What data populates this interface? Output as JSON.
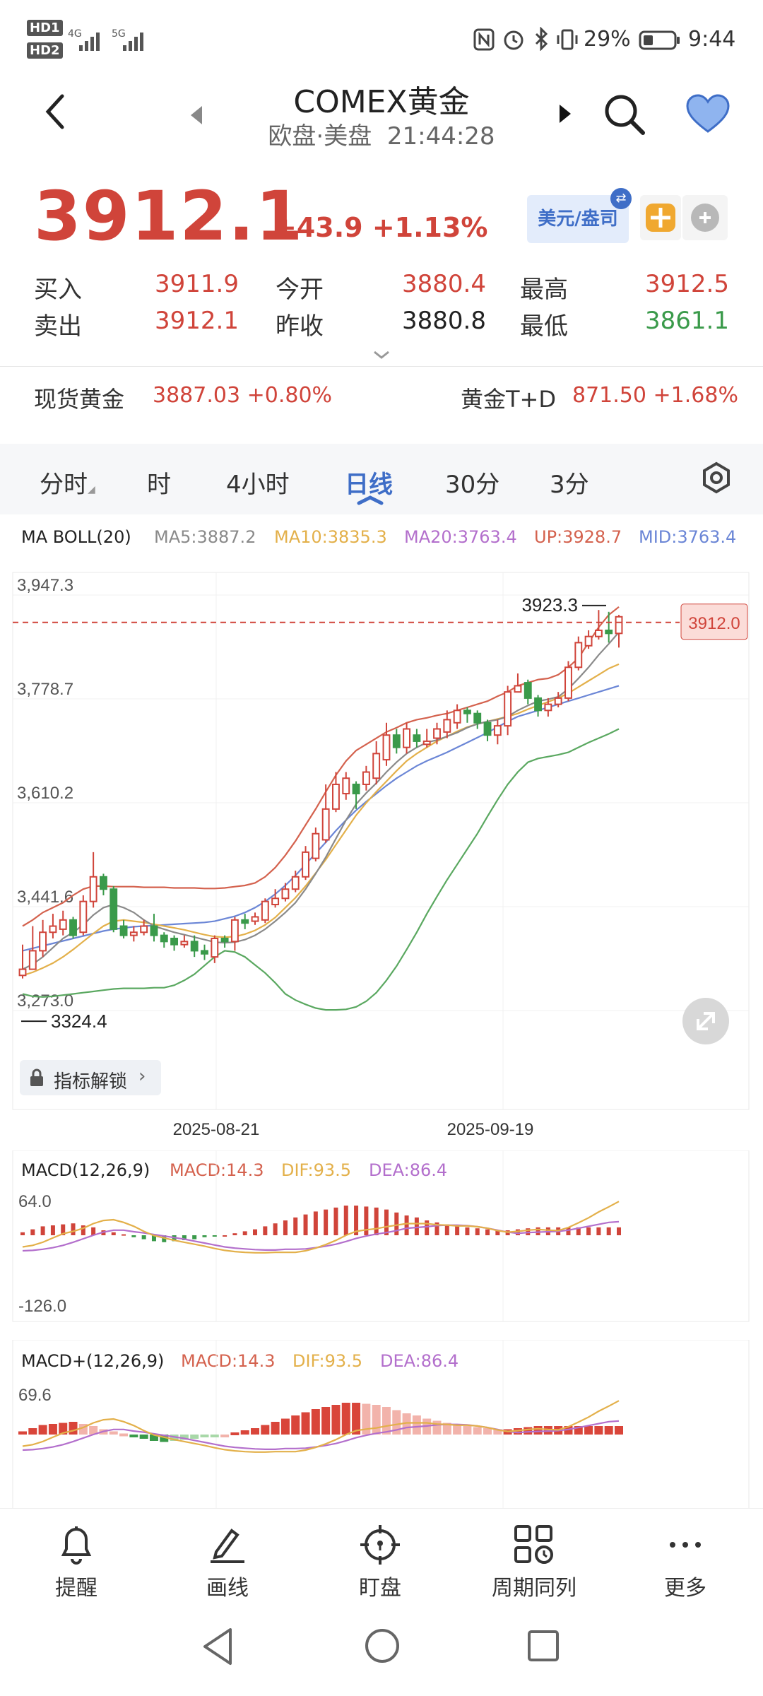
{
  "status_bar": {
    "hd1": "HD1",
    "hd2": "HD2",
    "net1": "4G",
    "net2": "5G",
    "battery": "29%",
    "time": "9:44"
  },
  "header": {
    "title": "COMEX黄金",
    "session": "欧盘·美盘",
    "clock": "21:44:28"
  },
  "quote": {
    "price": "3912.1",
    "change": "+43.9 +1.13%",
    "currency_badge": "美元/盎司",
    "rows": [
      {
        "l1": "买入",
        "v1": "3911.9",
        "l2": "今开",
        "v2": "3880.4",
        "l3": "最高",
        "v3": "3912.5"
      },
      {
        "l1": "卖出",
        "v1": "3912.1",
        "l2": "昨收",
        "v2": "3880.8",
        "l3": "最低",
        "v3": "3861.1"
      }
    ]
  },
  "related": {
    "left_label": "现货黄金",
    "left_value": "3887.03 +0.80%",
    "right_label": "黄金T+D",
    "right_value": "871.50 +1.68%"
  },
  "tabs": [
    "分时",
    "时",
    "4小时",
    "日线",
    "30分",
    "3分"
  ],
  "indicator_bar": {
    "name": "MA BOLL(20)",
    "ma5": "MA5:3887.2",
    "ma10": "MA10:3835.3",
    "ma20": "MA20:3763.4",
    "up": "UP:3928.7",
    "mid": "MID:3763.4"
  },
  "chart_data": {
    "type": "candlestick",
    "y_ticks": [
      "3,947.3",
      "3,778.7",
      "3,610.2",
      "3,441.6",
      "3,273.0"
    ],
    "ylim": [
      3273.0,
      3947.3
    ],
    "x_ticks": [
      "2025-08-21",
      "2025-09-19"
    ],
    "max_label": "3923.3",
    "min_label": "3324.4",
    "current_label": "3912.0",
    "candles": [
      [
        3340,
        3330,
        3380,
        3325
      ],
      [
        3370,
        3340,
        3410,
        3340
      ],
      [
        3400,
        3370,
        3420,
        3360
      ],
      [
        3410,
        3400,
        3430,
        3390
      ],
      [
        3420,
        3405,
        3435,
        3395
      ],
      [
        3395,
        3420,
        3425,
        3390
      ],
      [
        3450,
        3400,
        3460,
        3395
      ],
      [
        3490,
        3450,
        3530,
        3440
      ],
      [
        3470,
        3490,
        3495,
        3460
      ],
      [
        3405,
        3470,
        3475,
        3400
      ],
      [
        3395,
        3410,
        3420,
        3390
      ],
      [
        3400,
        3395,
        3410,
        3385
      ],
      [
        3410,
        3400,
        3420,
        3395
      ],
      [
        3395,
        3410,
        3430,
        3385
      ],
      [
        3385,
        3395,
        3400,
        3375
      ],
      [
        3380,
        3390,
        3395,
        3370
      ],
      [
        3385,
        3380,
        3395,
        3375
      ],
      [
        3370,
        3385,
        3395,
        3360
      ],
      [
        3365,
        3370,
        3380,
        3355
      ],
      [
        3390,
        3360,
        3395,
        3350
      ],
      [
        3385,
        3390,
        3395,
        3375
      ],
      [
        3420,
        3385,
        3425,
        3370
      ],
      [
        3415,
        3420,
        3430,
        3405
      ],
      [
        3425,
        3418,
        3432,
        3412
      ],
      [
        3450,
        3420,
        3455,
        3415
      ],
      [
        3455,
        3445,
        3470,
        3440
      ],
      [
        3470,
        3455,
        3480,
        3450
      ],
      [
        3490,
        3470,
        3500,
        3465
      ],
      [
        3530,
        3490,
        3540,
        3485
      ],
      [
        3560,
        3520,
        3570,
        3515
      ],
      [
        3600,
        3550,
        3640,
        3545
      ],
      [
        3640,
        3600,
        3660,
        3595
      ],
      [
        3650,
        3625,
        3660,
        3615
      ],
      [
        3625,
        3640,
        3645,
        3600
      ],
      [
        3660,
        3640,
        3670,
        3630
      ],
      [
        3690,
        3650,
        3710,
        3640
      ],
      [
        3720,
        3680,
        3740,
        3670
      ],
      [
        3700,
        3720,
        3730,
        3690
      ],
      [
        3730,
        3700,
        3740,
        3690
      ],
      [
        3710,
        3720,
        3730,
        3700
      ],
      [
        3710,
        3705,
        3730,
        3700
      ],
      [
        3730,
        3715,
        3740,
        3705
      ],
      [
        3745,
        3725,
        3760,
        3715
      ],
      [
        3760,
        3740,
        3770,
        3730
      ],
      [
        3755,
        3760,
        3765,
        3740
      ],
      [
        3740,
        3755,
        3760,
        3730
      ],
      [
        3720,
        3740,
        3745,
        3710
      ],
      [
        3735,
        3720,
        3745,
        3705
      ],
      [
        3790,
        3735,
        3800,
        3720
      ],
      [
        3800,
        3790,
        3820,
        3790
      ],
      [
        3780,
        3805,
        3810,
        3770
      ],
      [
        3760,
        3780,
        3785,
        3750
      ],
      [
        3770,
        3760,
        3780,
        3750
      ],
      [
        3780,
        3770,
        3790,
        3765
      ],
      [
        3830,
        3780,
        3840,
        3775
      ],
      [
        3870,
        3830,
        3880,
        3825
      ],
      [
        3880,
        3865,
        3890,
        3860
      ],
      [
        3890,
        3880,
        3923,
        3875
      ],
      [
        3885,
        3890,
        3920,
        3870
      ],
      [
        3912,
        3885,
        3915,
        3862
      ]
    ],
    "lines": {
      "boll_up": [
        3410,
        3420,
        3432,
        3440,
        3448,
        3460,
        3470,
        3475,
        3475,
        3474,
        3474,
        3474,
        3473,
        3473,
        3473,
        3472,
        3472,
        3472,
        3471,
        3471,
        3472,
        3474,
        3476,
        3480,
        3490,
        3505,
        3525,
        3548,
        3574,
        3600,
        3628,
        3655,
        3678,
        3695,
        3705,
        3715,
        3725,
        3732,
        3740,
        3745,
        3748,
        3752,
        3755,
        3760,
        3765,
        3770,
        3775,
        3783,
        3790,
        3800,
        3805,
        3810,
        3812,
        3818,
        3830,
        3845,
        3870,
        3895,
        3915,
        3928
      ],
      "mid": [
        3370,
        3374,
        3378,
        3382,
        3386,
        3390,
        3394,
        3398,
        3402,
        3405,
        3407,
        3409,
        3410,
        3411,
        3412,
        3413,
        3414,
        3415,
        3416,
        3418,
        3422,
        3426,
        3432,
        3440,
        3450,
        3462,
        3476,
        3492,
        3510,
        3528,
        3546,
        3565,
        3582,
        3598,
        3612,
        3625,
        3638,
        3650,
        3660,
        3670,
        3678,
        3685,
        3692,
        3700,
        3708,
        3716,
        3724,
        3733,
        3742,
        3750,
        3755,
        3760,
        3765,
        3770,
        3775,
        3780,
        3785,
        3790,
        3795,
        3800
      ],
      "boll_low": [
        3300,
        3296,
        3295,
        3296,
        3298,
        3300,
        3302,
        3304,
        3306,
        3308,
        3309,
        3309,
        3309,
        3310,
        3310,
        3314,
        3322,
        3332,
        3346,
        3360,
        3370,
        3368,
        3360,
        3347,
        3334,
        3318,
        3300,
        3290,
        3283,
        3277,
        3274,
        3274,
        3275,
        3279,
        3288,
        3302,
        3322,
        3345,
        3372,
        3400,
        3430,
        3458,
        3485,
        3510,
        3535,
        3560,
        3588,
        3615,
        3640,
        3660,
        3676,
        3682,
        3685,
        3688,
        3692,
        3700,
        3708,
        3715,
        3722,
        3730
      ],
      "ma5": [
        3340,
        3348,
        3360,
        3375,
        3390,
        3400,
        3412,
        3428,
        3440,
        3445,
        3440,
        3432,
        3420,
        3410,
        3405,
        3400,
        3396,
        3392,
        3388,
        3384,
        3383,
        3384,
        3388,
        3395,
        3405,
        3418,
        3432,
        3448,
        3470,
        3495,
        3522,
        3552,
        3582,
        3608,
        3626,
        3642,
        3660,
        3676,
        3690,
        3700,
        3708,
        3712,
        3718,
        3724,
        3732,
        3738,
        3742,
        3745,
        3750,
        3760,
        3768,
        3775,
        3778,
        3782,
        3795,
        3812,
        3830,
        3850,
        3868,
        3887
      ],
      "ma10": [
        3330,
        3335,
        3342,
        3350,
        3360,
        3372,
        3385,
        3398,
        3410,
        3418,
        3420,
        3418,
        3416,
        3413,
        3410,
        3407,
        3404,
        3400,
        3396,
        3393,
        3392,
        3393,
        3397,
        3403,
        3412,
        3424,
        3440,
        3456,
        3475,
        3496,
        3518,
        3542,
        3566,
        3590,
        3610,
        3628,
        3645,
        3662,
        3678,
        3690,
        3700,
        3710,
        3718,
        3726,
        3733,
        3738,
        3742,
        3746,
        3750,
        3755,
        3762,
        3768,
        3774,
        3780,
        3788,
        3798,
        3808,
        3818,
        3828,
        3835
      ]
    }
  },
  "chart_misc": {
    "unlock_label": "指标解锁"
  },
  "macd1": {
    "name": "MACD(12,26,9)",
    "macd": "MACD:14.3",
    "dif": "DIF:93.5",
    "dea": "DEA:86.4",
    "ticks": [
      "64.0",
      "-126.0"
    ],
    "hist": [
      3,
      6,
      9,
      10,
      11,
      12,
      10,
      8,
      5,
      3,
      1,
      -2,
      -4,
      -6,
      -7,
      -6,
      -5,
      -4,
      -2,
      -1,
      0,
      2,
      4,
      6,
      9,
      12,
      15,
      18,
      21,
      24,
      26,
      28,
      30,
      30,
      29,
      28,
      26,
      23,
      20,
      18,
      15,
      13,
      11,
      9,
      8,
      7,
      6,
      5,
      5,
      6,
      7,
      8,
      8,
      8,
      8,
      8,
      8,
      8,
      8,
      8
    ]
  },
  "macd2": {
    "name": "MACD+(12,26,9)",
    "macd": "MACD:14.3",
    "dif": "DIF:93.5",
    "dea": "DEA:86.4",
    "ticks": [
      "69.6"
    ]
  },
  "bottom_nav": [
    {
      "label": "提醒",
      "icon": "bell-icon"
    },
    {
      "label": "画线",
      "icon": "pencil-icon"
    },
    {
      "label": "盯盘",
      "icon": "target-icon"
    },
    {
      "label": "周期同列",
      "icon": "grid-clock-icon"
    },
    {
      "label": "更多",
      "icon": "more-icon"
    }
  ],
  "colors": {
    "up": "#d0443a",
    "down": "#3a9a4a",
    "accent": "#3f6ec7",
    "boll_up": "#d4624e",
    "mid": "#6b86d6",
    "boll_low": "#5aa860",
    "ma5": "#8a8a8a",
    "ma10": "#e3b04a",
    "ma20": "#b36fcc"
  }
}
